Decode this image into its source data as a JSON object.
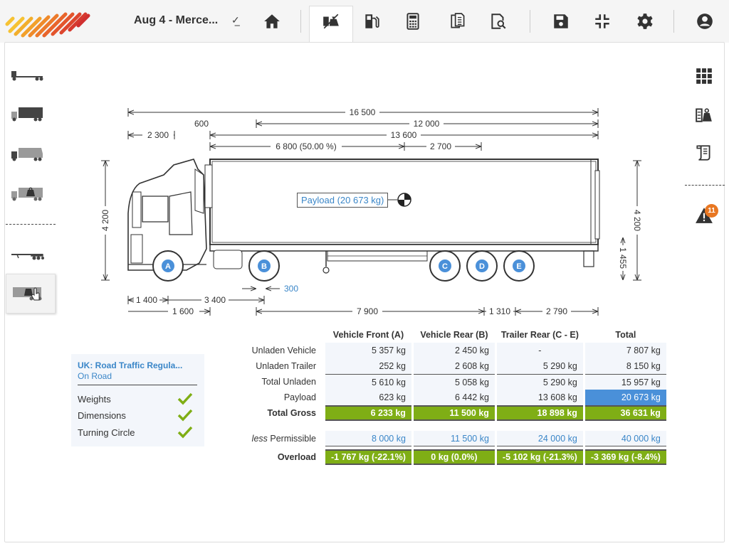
{
  "header": {
    "document_title": "Aug 4 - Merce...",
    "title_icon": "check-mark-underline-icon",
    "toolbar": [
      {
        "name": "home",
        "icon": "home-icon"
      },
      {
        "name": "weights",
        "icon": "truck-weight-icon",
        "active": true
      },
      {
        "name": "fuel",
        "icon": "fuel-pump-icon"
      },
      {
        "name": "calculator",
        "icon": "calculator-icon"
      },
      {
        "name": "documents",
        "icon": "documents-icon"
      },
      {
        "name": "report-preview",
        "icon": "document-search-icon"
      },
      {
        "name": "save",
        "icon": "save-icon"
      },
      {
        "name": "compress",
        "icon": "compress-icon"
      },
      {
        "name": "settings",
        "icon": "gear-icon"
      },
      {
        "name": "account",
        "icon": "user-icon"
      }
    ]
  },
  "left_sidebar": [
    {
      "name": "chassis",
      "icon": "truck-chassis-icon"
    },
    {
      "name": "rigid-body",
      "icon": "rigid-truck-body-icon"
    },
    {
      "name": "tipper-body",
      "icon": "truck-tipper-icon"
    },
    {
      "name": "truck-payload",
      "icon": "truck-payload-icon"
    },
    {
      "name": "trailer-chassis",
      "icon": "trailer-chassis-icon"
    },
    {
      "name": "trailer-payload",
      "icon": "trailer-payload-icon",
      "selected": true
    }
  ],
  "right_sidebar": [
    {
      "name": "apps",
      "icon": "grid-icon"
    },
    {
      "name": "weight-summary",
      "icon": "scale-weight-icon"
    },
    {
      "name": "report",
      "icon": "scroll-report-icon"
    },
    {
      "name": "warnings",
      "icon": "warning-icon",
      "badge": "11"
    }
  ],
  "drawing": {
    "dims": {
      "overall_length": "16 500",
      "trailer_length": "12 000",
      "front_overhang_offset": "600",
      "cab_to_body": "2 300",
      "body_length": "13 600",
      "payload_cog": "6 800 (50.00 %)",
      "cog_remaining": "2 700",
      "overall_height": "4 200",
      "trailer_height": "4 200",
      "deck_height": "1 455",
      "front_overhang": "1 400",
      "wheelbase": "3 400",
      "fifth_wheel_offset": "300",
      "cab_to_axle": "1 600",
      "kingpin_to_axle": "7 900",
      "axle_spread": "1 310",
      "rear_overhang": "2 790"
    },
    "payload_label": "Payload (20 673 kg)",
    "axles": [
      "A",
      "B",
      "C",
      "D",
      "E"
    ]
  },
  "compliance": {
    "title": "UK: Road Traffic Regula...",
    "subtitle": "On Road",
    "checks": [
      {
        "label": "Weights",
        "status": "pass"
      },
      {
        "label": "Dimensions",
        "status": "pass"
      },
      {
        "label": "Turning Circle",
        "status": "pass"
      }
    ]
  },
  "weights_table": {
    "columns": [
      "Vehicle Front (A)",
      "Vehicle Rear (B)",
      "Trailer Rear (C - E)",
      "Total"
    ],
    "rows": {
      "unladen_vehicle": {
        "label": "Unladen Vehicle",
        "values": [
          "5 357 kg",
          "2 450 kg",
          "-",
          "7 807 kg"
        ]
      },
      "unladen_trailer": {
        "label": "Unladen Trailer",
        "values": [
          "252 kg",
          "2 608 kg",
          "5 290 kg",
          "8 150 kg"
        ]
      },
      "total_unladen": {
        "label": "Total Unladen",
        "values": [
          "5 610 kg",
          "5 058 kg",
          "5 290 kg",
          "15 957 kg"
        ]
      },
      "payload": {
        "label": "Payload",
        "values": [
          "623 kg",
          "6 442 kg",
          "13 608 kg",
          "20 673 kg"
        ]
      },
      "total_gross": {
        "label": "Total Gross",
        "values": [
          "6 233 kg",
          "11 500 kg",
          "18 898 kg",
          "36 631 kg"
        ]
      },
      "permissible": {
        "label_prefix": "less",
        "label": "Permissible",
        "values": [
          "8 000 kg",
          "11 500 kg",
          "24 000 kg",
          "40 000 kg"
        ]
      },
      "overload": {
        "label": "Overload",
        "values": [
          "-1 767 kg (-22.1%)",
          "0 kg (0.0%)",
          "-5 102 kg (-21.3%)",
          "-3 369 kg (-8.4%)"
        ]
      }
    }
  },
  "colors": {
    "accent_blue": "#3a86c8",
    "pass_green": "#7fae15",
    "highlight_blue": "#4a90d9",
    "warning_orange": "#e87722"
  }
}
